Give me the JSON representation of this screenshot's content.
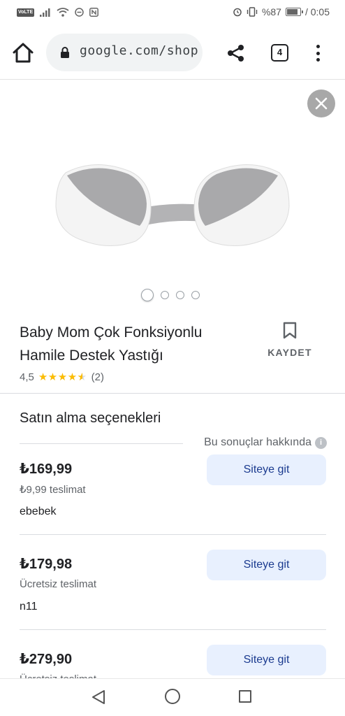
{
  "status_bar": {
    "network_badge": "VoLTE",
    "battery_text": "%87",
    "battery_level_percent": 87,
    "time": "0:05"
  },
  "browser": {
    "url": "google.com/shop",
    "tab_count": "4"
  },
  "product": {
    "title": "Baby Mom Çok Fonksiyonlu Hamile Destek Yastığı",
    "save_label": "KAYDET",
    "rating_value": "4,5",
    "stars": 4.5,
    "review_count": "(2)",
    "image_count": 4,
    "active_image": 1
  },
  "purchase": {
    "section_title": "Satın alma seçenekleri",
    "about_results": "Bu sonuçlar hakkında",
    "offers": [
      {
        "price": "₺169,99",
        "shipping": "₺9,99 teslimat",
        "store": "ebebek",
        "button": "Siteye git"
      },
      {
        "price": "₺179,98",
        "shipping": "Ücretsiz teslimat",
        "store": "n11",
        "button": "Siteye git"
      },
      {
        "price": "₺279,90",
        "shipping": "Ücretsiz teslimat",
        "store": "",
        "button": "Siteye git"
      }
    ]
  },
  "colors": {
    "button_bg": "#e8f0fe",
    "button_text": "#1a3a8f",
    "star": "#fbbc04",
    "pillow_gray": "#a9a9ab",
    "pillow_white": "#f4f4f4"
  }
}
